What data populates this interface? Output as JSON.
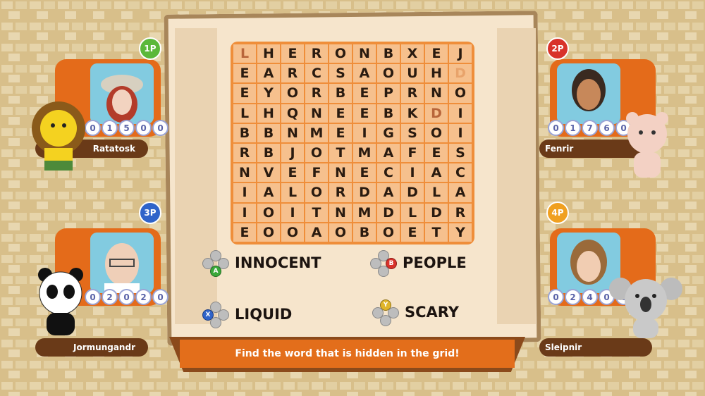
{
  "grid": [
    [
      "L",
      "H",
      "E",
      "R",
      "O",
      "N",
      "B",
      "X",
      "E",
      "J"
    ],
    [
      "E",
      "A",
      "R",
      "C",
      "S",
      "A",
      "O",
      "U",
      "H",
      "D"
    ],
    [
      "E",
      "Y",
      "O",
      "R",
      "B",
      "E",
      "P",
      "R",
      "N",
      "O"
    ],
    [
      "L",
      "H",
      "Q",
      "N",
      "E",
      "E",
      "B",
      "K",
      "D",
      "I"
    ],
    [
      "B",
      "B",
      "N",
      "M",
      "E",
      "I",
      "G",
      "S",
      "O",
      "I"
    ],
    [
      "R",
      "B",
      "J",
      "O",
      "T",
      "M",
      "A",
      "F",
      "E",
      "S"
    ],
    [
      "N",
      "V",
      "E",
      "F",
      "N",
      "E",
      "C",
      "I",
      "A",
      "C"
    ],
    [
      "I",
      "A",
      "L",
      "O",
      "R",
      "D",
      "A",
      "D",
      "L",
      "A"
    ],
    [
      "I",
      "O",
      "I",
      "T",
      "N",
      "M",
      "D",
      "L",
      "D",
      "R"
    ],
    [
      "E",
      "O",
      "O",
      "A",
      "O",
      "B",
      "O",
      "E",
      "T",
      "Y"
    ]
  ],
  "words": [
    {
      "label": "INNOCENT",
      "button": "A",
      "color": "#3aa83a"
    },
    {
      "label": "PEOPLE",
      "button": "B",
      "color": "#d8322a"
    },
    {
      "label": "LIQUID",
      "button": "X",
      "color": "#2f63c9"
    },
    {
      "label": "SCARY",
      "button": "Y",
      "color": "#e0b52a"
    }
  ],
  "instruction": "Find the word that is hidden in the grid!",
  "players": [
    {
      "rank": "1P",
      "name": "Ratatosk",
      "score": [
        "0",
        "1",
        "5",
        "0",
        "0"
      ],
      "badge_color": "#5bb83a"
    },
    {
      "rank": "2P",
      "name": "Fenrir",
      "score": [
        "0",
        "1",
        "7",
        "6",
        "0"
      ],
      "badge_color": "#d8322a"
    },
    {
      "rank": "3P",
      "name": "Jormungandr",
      "score": [
        "0",
        "2",
        "0",
        "2",
        "0"
      ],
      "badge_color": "#2f63c9"
    },
    {
      "rank": "4P",
      "name": "Sleipnir",
      "score": [
        "0",
        "2",
        "4",
        "0",
        "0"
      ],
      "badge_color": "#f0a020"
    }
  ]
}
